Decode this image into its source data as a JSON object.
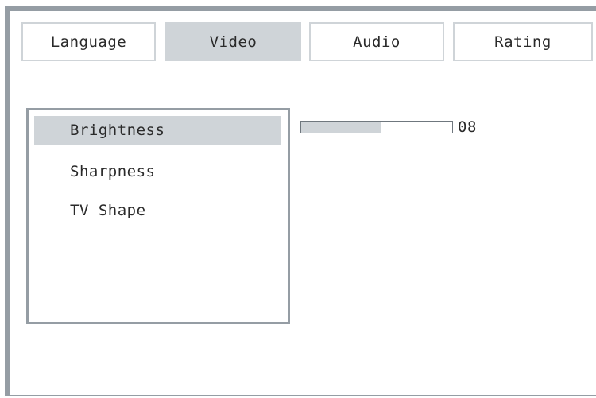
{
  "tabs": [
    {
      "label": "Language",
      "active": false
    },
    {
      "label": "Video",
      "active": true
    },
    {
      "label": "Audio",
      "active": false
    },
    {
      "label": "Rating",
      "active": false
    }
  ],
  "menu": {
    "items": [
      {
        "label": "Brightness",
        "selected": true
      },
      {
        "label": "Sharpness",
        "selected": false
      },
      {
        "label": "TV Shape",
        "selected": false
      }
    ]
  },
  "brightness": {
    "value_text": "08",
    "level_fraction": 0.53
  },
  "colors": {
    "frame": "#959da4",
    "highlight": "#cfd4d8",
    "text": "#2a2a2a",
    "background": "#ffffff"
  }
}
